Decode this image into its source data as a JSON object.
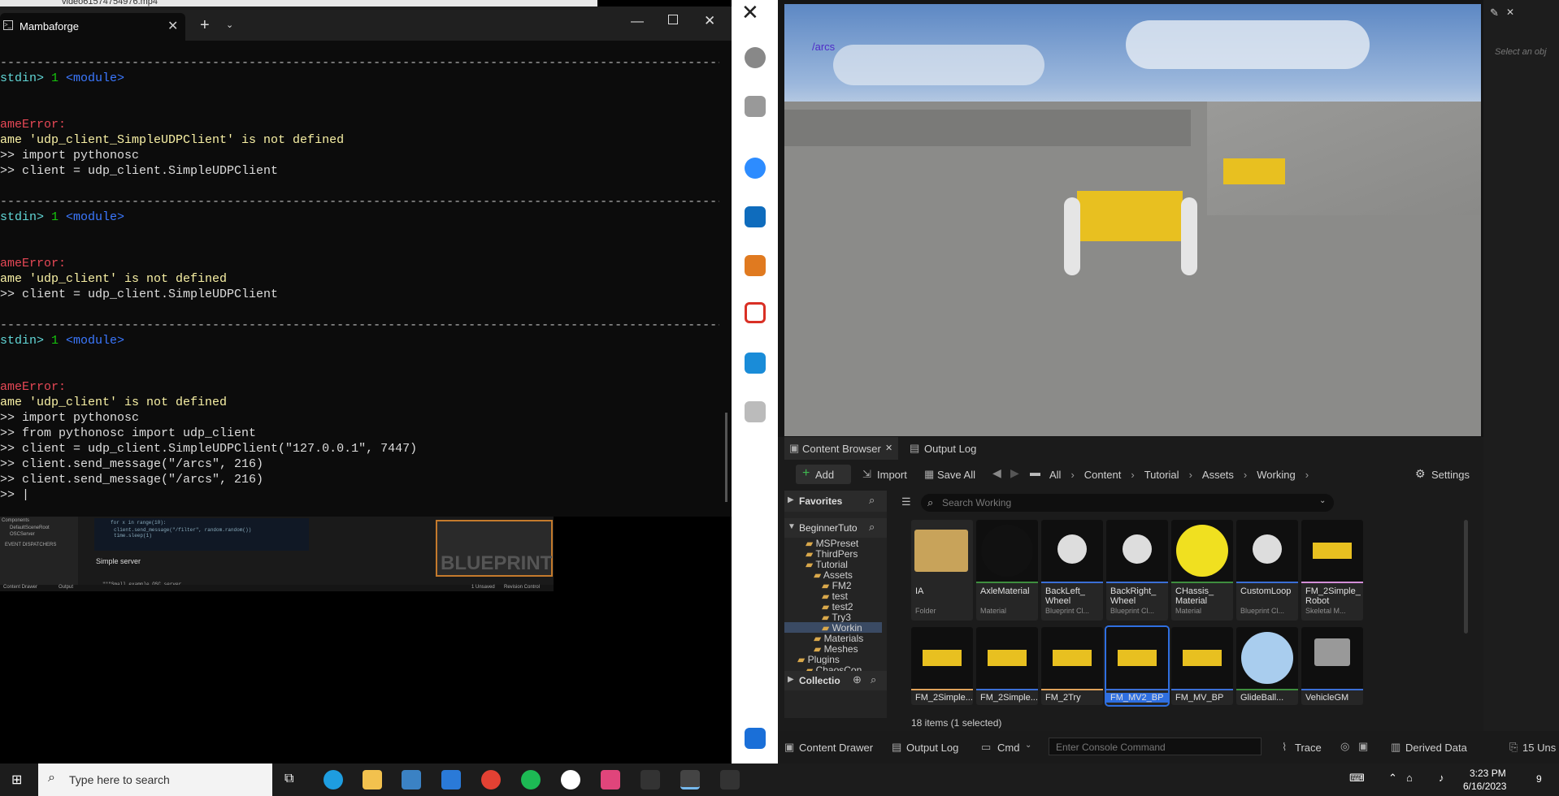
{
  "terminal": {
    "tab_title": "Mambaforge",
    "top_strip_text": "video61574754976.mp4",
    "lines": [
      {
        "segs": [
          {
            "t": "-------------------------------------------------------------------------------------------------------------",
            "c": "dash"
          }
        ]
      },
      {
        "segs": [
          {
            "t": "stdin>",
            "c": "tb"
          },
          {
            "t": " 1 ",
            "c": "num"
          },
          {
            "t": "<module>",
            "c": "mod"
          }
        ]
      },
      {
        "segs": [
          {
            "t": "",
            "c": ""
          }
        ]
      },
      {
        "segs": [
          {
            "t": "",
            "c": ""
          }
        ]
      },
      {
        "segs": [
          {
            "t": "ameError:",
            "c": "err"
          }
        ]
      },
      {
        "segs": [
          {
            "t": "ame 'udp_client_SimpleUDPClient' is not defined",
            "c": "msg"
          }
        ]
      },
      {
        "segs": [
          {
            "t": ">> import pythonosc",
            "c": ""
          }
        ]
      },
      {
        "segs": [
          {
            "t": ">> client = udp_client.SimpleUDPClient",
            "c": ""
          }
        ]
      },
      {
        "segs": [
          {
            "t": "",
            "c": ""
          }
        ]
      },
      {
        "segs": [
          {
            "t": "-------------------------------------------------------------------------------------------------------------",
            "c": "dash"
          }
        ]
      },
      {
        "segs": [
          {
            "t": "stdin>",
            "c": "tb"
          },
          {
            "t": " 1 ",
            "c": "num"
          },
          {
            "t": "<module>",
            "c": "mod"
          }
        ]
      },
      {
        "segs": [
          {
            "t": "",
            "c": ""
          }
        ]
      },
      {
        "segs": [
          {
            "t": "",
            "c": ""
          }
        ]
      },
      {
        "segs": [
          {
            "t": "ameError:",
            "c": "err"
          }
        ]
      },
      {
        "segs": [
          {
            "t": "ame 'udp_client' is not defined",
            "c": "msg"
          }
        ]
      },
      {
        "segs": [
          {
            "t": ">> client = udp_client.SimpleUDPClient",
            "c": ""
          }
        ]
      },
      {
        "segs": [
          {
            "t": "",
            "c": ""
          }
        ]
      },
      {
        "segs": [
          {
            "t": "-------------------------------------------------------------------------------------------------------------",
            "c": "dash"
          }
        ]
      },
      {
        "segs": [
          {
            "t": "stdin>",
            "c": "tb"
          },
          {
            "t": " 1 ",
            "c": "num"
          },
          {
            "t": "<module>",
            "c": "mod"
          }
        ]
      },
      {
        "segs": [
          {
            "t": "",
            "c": ""
          }
        ]
      },
      {
        "segs": [
          {
            "t": "",
            "c": ""
          }
        ]
      },
      {
        "segs": [
          {
            "t": "ameError:",
            "c": "err"
          }
        ]
      },
      {
        "segs": [
          {
            "t": "ame 'udp_client' is not defined",
            "c": "msg"
          }
        ]
      },
      {
        "segs": [
          {
            "t": ">> import pythonosc",
            "c": ""
          }
        ]
      },
      {
        "segs": [
          {
            "t": ">> from pythonosc import udp_client",
            "c": ""
          }
        ]
      },
      {
        "segs": [
          {
            "t": ">> client = udp_client.SimpleUDPClient(\"127.0.0.1\", 7447)",
            "c": ""
          }
        ]
      },
      {
        "segs": [
          {
            "t": ">> client.send_message(\"/arcs\", 216)",
            "c": ""
          }
        ]
      },
      {
        "segs": [
          {
            "t": ">> client.send_message(\"/arcs\", 216)",
            "c": ""
          }
        ]
      },
      {
        "segs": [
          {
            "t": ">> |",
            "c": ""
          }
        ]
      }
    ]
  },
  "preview": {
    "components": "Components",
    "default_scene_root": "DefaultSceneRoot",
    "osc_server": "OSCServer",
    "event_dispatchers": "EVENT DISPATCHERS",
    "code1": "for x in range(10):",
    "code2": "client.send_message(\"/filter\", random.random())",
    "code3": "time.sleep(1)",
    "simple_server": "Simple server",
    "small_example": "\"\"\"Small example OSC server",
    "blueprint": "BLUEPRINT",
    "content_drawer": "Content Drawer",
    "output": "Output",
    "unsaved": "1 Unsaved",
    "revision": "Revision Control"
  },
  "unreal": {
    "viewport_label": "/arcs",
    "details_placeholder": "Select an obj",
    "tabs": {
      "content_browser": "Content Browser",
      "output_log": "Output Log"
    },
    "toolbar": {
      "add": "Add",
      "import": "Import",
      "save_all": "Save All",
      "settings": "Settings"
    },
    "breadcrumb": [
      "All",
      "Content",
      "Tutorial",
      "Assets",
      "Working"
    ],
    "favorites": "Favorites",
    "project": "BeginnerTuto",
    "search_placeholder": "Search Working",
    "tree": [
      "MSPreset",
      "ThirdPers",
      "Tutorial",
      "Assets",
      "FM2",
      "test",
      "test2",
      "Try3",
      "Workin",
      "Materials",
      "Meshes",
      "Plugins",
      "ChaosCon"
    ],
    "collections": "Collectio",
    "assets_row1": [
      {
        "name": "IA",
        "type": "Folder",
        "bar": "#262626"
      },
      {
        "name": "AxleMaterial",
        "type": "Material",
        "bar": "#3e8e3e"
      },
      {
        "name": "BackLeft_ Wheel",
        "type": "Blueprint Cl...",
        "bar": "#3b6fd6"
      },
      {
        "name": "BackRight_ Wheel",
        "type": "Blueprint Cl...",
        "bar": "#3b6fd6"
      },
      {
        "name": "CHassis_ Material",
        "type": "Material",
        "bar": "#3e8e3e"
      },
      {
        "name": "CustomLoop",
        "type": "Blueprint Cl...",
        "bar": "#3b6fd6"
      },
      {
        "name": "FM_2Simple_ Robot",
        "type": "Skeletal M...",
        "bar": "#d38ed8"
      }
    ],
    "assets_row2": [
      {
        "name": "FM_2Simple...",
        "bar": "#e0a25a"
      },
      {
        "name": "FM_2Simple...",
        "bar": "#3b6fd6"
      },
      {
        "name": "FM_2Try",
        "bar": "#e0a25a"
      },
      {
        "name": "FM_MV2_BP",
        "bar": "#3b6fd6"
      },
      {
        "name": "FM_MV_BP",
        "bar": "#3b6fd6"
      },
      {
        "name": "GlideBall...",
        "bar": "#3e8e3e"
      },
      {
        "name": "VehicleGM",
        "bar": "#3b6fd6"
      }
    ],
    "items_count": "18 items (1 selected)",
    "status": {
      "content_drawer": "Content Drawer",
      "output_log": "Output Log",
      "cmd": "Cmd",
      "console_placeholder": "Enter Console Command",
      "trace": "Trace",
      "derived_data": "Derived Data",
      "unsaved": "15 Uns"
    }
  },
  "taskbar": {
    "search_placeholder": "Type here to search",
    "time": "3:23 PM",
    "date": "6/16/2023",
    "notifications": "9"
  }
}
